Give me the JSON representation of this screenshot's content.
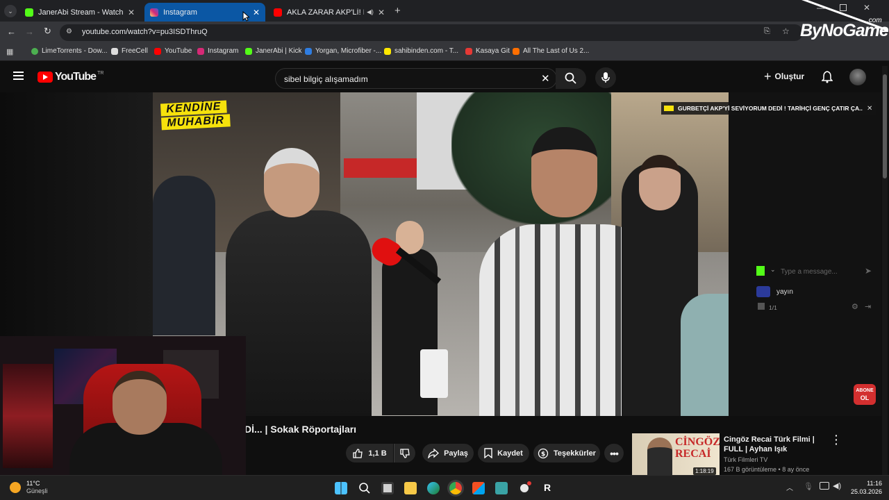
{
  "browser": {
    "tabs": [
      {
        "title": "JanerAbi Stream - Watch Live o",
        "favicon": "kick-icon",
        "active": false
      },
      {
        "title": "Instagram",
        "favicon": "instagram-icon",
        "active": true
      },
      {
        "title": "AKLA ZARAR AKP'Lİ! MUH",
        "favicon": "youtube-icon",
        "active": false
      }
    ],
    "url": "youtube.com/watch?v=pu3ISDThruQ",
    "bookmarks": [
      {
        "label": "LimeTorrents - Dow...",
        "color": "#4caf50"
      },
      {
        "label": "FreeCell",
        "color": "#dddddd"
      },
      {
        "label": "YouTube",
        "color": "#ff0000"
      },
      {
        "label": "Instagram",
        "color": "#d62976"
      },
      {
        "label": "JanerAbi | Kick",
        "color": "#53fc18"
      },
      {
        "label": "Yorgan, Microfiber -...",
        "color": "#2f7de1"
      },
      {
        "label": "sahibinden.com - T...",
        "color": "#ffe800"
      },
      {
        "label": "Kasaya Git",
        "color": "#e53935"
      },
      {
        "label": "All The Last of Us 2...",
        "color": "#ff6f00"
      }
    ]
  },
  "youtube": {
    "logo_text": "YouTube",
    "country": "TR",
    "search_value": "sibel bilgiç alışamadım",
    "create_label": "Oluştur",
    "video_overlay_line1": "KENDİNE",
    "video_overlay_line2": "MUHABİR",
    "video_title_partial": "Dİ... | Sokak Röportajları",
    "like_count": "1,1 B",
    "share_label": "Paylaş",
    "save_label": "Kaydet",
    "thanks_label": "Teşekkürler",
    "recommendation": {
      "title": "Cingöz Recai Türk Filmi | FULL | Ayhan Işık",
      "channel": "Türk Filmleri TV",
      "meta": "167 B görüntüleme • 8 ay önce",
      "thumb_text": "CİNGÖZ RECAİ",
      "duration": "1:18:19"
    }
  },
  "overlay": {
    "ticker": "GURBETÇİ AKP'Yİ SEVİYORUM DEDİ ! TARİHÇİ GENÇ ÇATIR ÇA...",
    "chat_placeholder": "Type a message...",
    "chat_user": "yayın",
    "chat_count": "1/1",
    "watermark": "ByNoGame",
    "watermark_sub": ".com",
    "abone_line1": "ABONE",
    "abone_line2": "OL"
  },
  "taskbar": {
    "temperature": "11°C",
    "weather": "Güneşli",
    "time": "11:16",
    "date": "25.03.2026"
  },
  "colors": {
    "youtube_red": "#ff0000",
    "kick_green": "#53fc18",
    "active_tab": "#0b57a4"
  }
}
